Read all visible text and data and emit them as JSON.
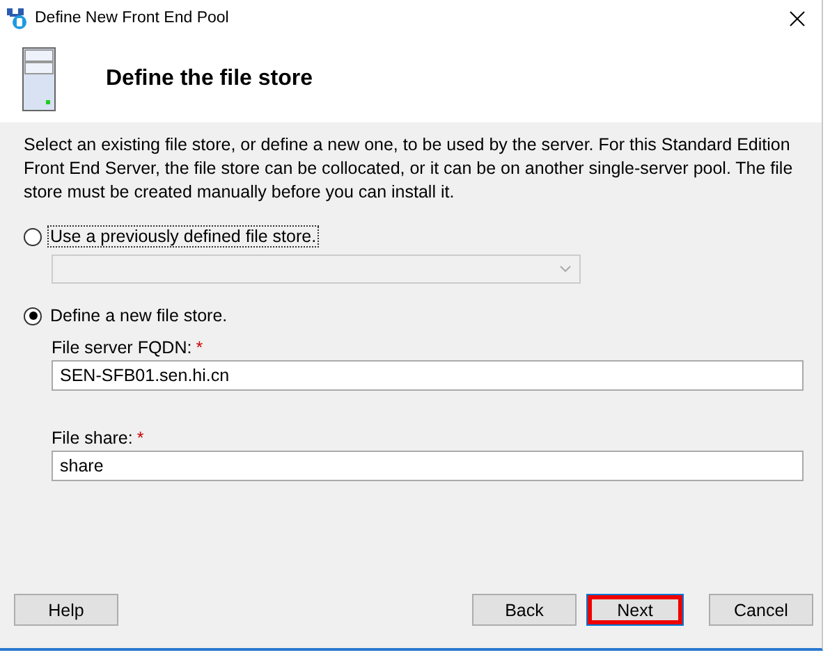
{
  "window": {
    "title": "Define New Front End Pool"
  },
  "header": {
    "title": "Define the file store"
  },
  "description": "Select an existing file store, or define a new one, to be used by the server. For this Standard Edition Front End Server, the file store can be collocated, or it can be on another single-server pool. The file store must be created manually before you can install it.",
  "options": [
    {
      "label": "Use a previously defined file store.",
      "selected": false,
      "focused": true
    },
    {
      "label": "Define a new file store.",
      "selected": true,
      "focused": false
    }
  ],
  "existing_store": {
    "disabled": true
  },
  "fields": [
    {
      "label": "File server FQDN:",
      "required_mark": "*",
      "value": "SEN-SFB01.sen.hi.cn"
    },
    {
      "label": "File share:",
      "required_mark": "*",
      "value": "share"
    }
  ],
  "buttons": [
    {
      "label": "Help",
      "default": false,
      "highlighted": false
    },
    {
      "label": "Back",
      "default": false,
      "highlighted": false
    },
    {
      "label": "Next",
      "default": true,
      "highlighted": true
    },
    {
      "label": "Cancel",
      "default": false,
      "highlighted": false
    }
  ]
}
